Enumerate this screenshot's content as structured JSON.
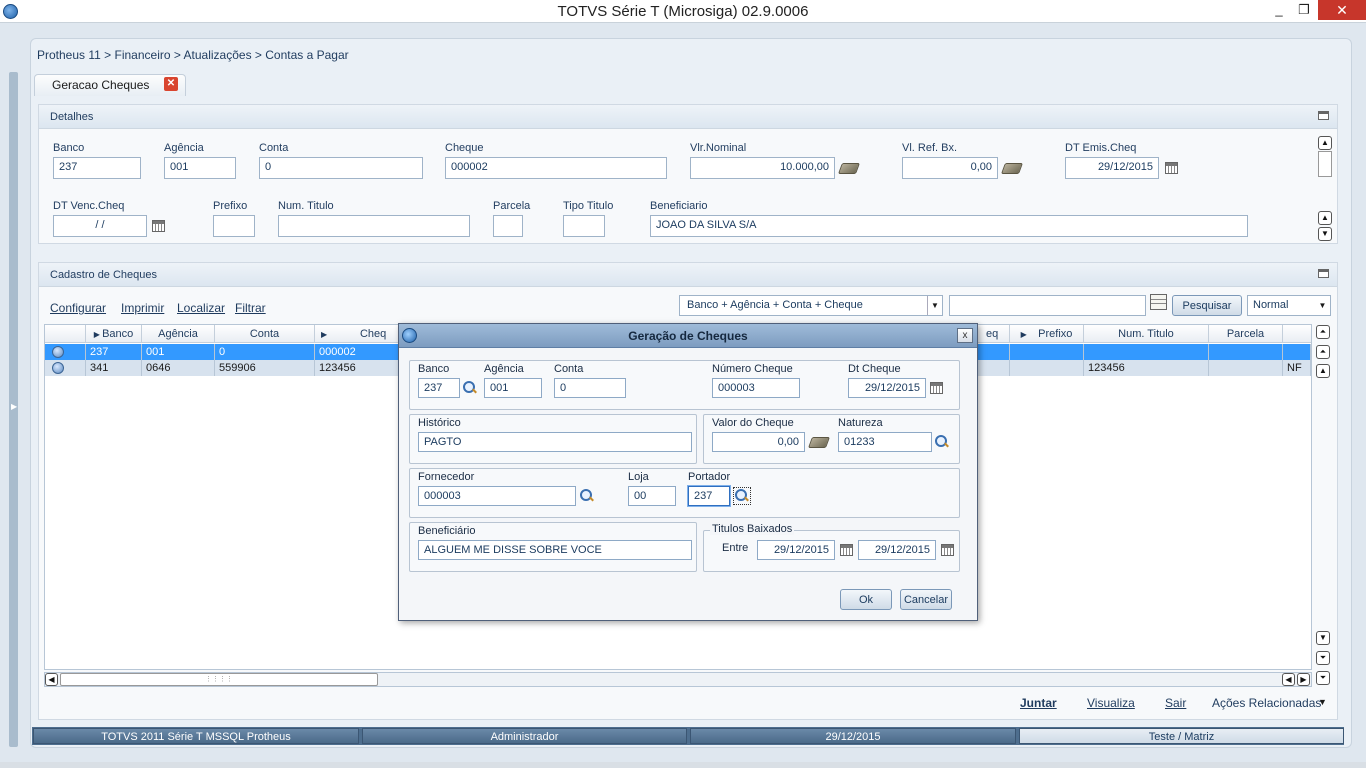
{
  "window": {
    "title": "TOTVS Série T  (Microsiga) 02.9.0006",
    "minimize": "_",
    "restore": "❐",
    "close": "✕"
  },
  "breadcrumb": "Protheus 11 > Financeiro > Atualizações > Contas a Pagar",
  "tab": {
    "label": "Geracao Cheques",
    "close": "✕"
  },
  "detalhes": {
    "title": "Detalhes",
    "fields": {
      "banco": {
        "label": "Banco",
        "value": "237"
      },
      "agencia": {
        "label": "Agência",
        "value": "001"
      },
      "conta": {
        "label": "Conta",
        "value": "0"
      },
      "cheque": {
        "label": "Cheque",
        "value": "000002"
      },
      "vlr_nominal": {
        "label": "Vlr.Nominal",
        "value": "10.000,00"
      },
      "vl_ref_bx": {
        "label": "Vl. Ref. Bx.",
        "value": "0,00"
      },
      "dt_emis": {
        "label": "DT Emis.Cheq",
        "value": "29/12/2015"
      },
      "dt_venc": {
        "label": "DT Venc.Cheq",
        "value": "  /  /"
      },
      "prefixo": {
        "label": "Prefixo",
        "value": ""
      },
      "num_titulo": {
        "label": "Num. Titulo",
        "value": ""
      },
      "parcela": {
        "label": "Parcela",
        "value": ""
      },
      "tipo_titulo": {
        "label": "Tipo Titulo",
        "value": ""
      },
      "beneficiario": {
        "label": "Beneficiario",
        "value": "JOAO DA SILVA S/A"
      }
    }
  },
  "cadastro": {
    "title": "Cadastro de Cheques",
    "links": {
      "configurar": "Configurar",
      "imprimir": "Imprimir",
      "localizar": "Localizar",
      "filtrar": "Filtrar"
    },
    "index_select": "Banco + Agência + Conta + Cheque",
    "search_value": "",
    "search_button": "Pesquisar",
    "view_select": "Normal",
    "columns": {
      "banco": "Banco",
      "agencia": "Agência",
      "conta": "Conta",
      "cheque": "Cheq",
      "cheque_right": "eq",
      "prefixo": "Prefixo",
      "num_titulo": "Num. Titulo",
      "parcela": "Parcela"
    },
    "rows": [
      {
        "banco": "237",
        "agencia": "001",
        "conta": "0",
        "cheque": "000002",
        "num_titulo": "",
        "tipo": ""
      },
      {
        "banco": "341",
        "agencia": "0646",
        "conta": "559906",
        "cheque": "123456",
        "num_titulo": "123456",
        "tipo": "NF"
      }
    ]
  },
  "footer": {
    "juntar": "Juntar",
    "visualiza": "Visualiza",
    "sair": "Sair",
    "acoes": "Ações Relacionadas"
  },
  "status": {
    "system": "TOTVS 2011 Série T  MSSQL Protheus",
    "user": "Administrador",
    "date": "29/12/2015",
    "company": "Teste / Matriz"
  },
  "dialog": {
    "title": "Geração de Cheques",
    "close": "x",
    "banco": {
      "label": "Banco",
      "value": "237"
    },
    "agencia": {
      "label": "Agência",
      "value": "001"
    },
    "conta": {
      "label": "Conta",
      "value": "0"
    },
    "numero_cheque": {
      "label": "Número Cheque",
      "value": "000003"
    },
    "dt_cheque": {
      "label": "Dt Cheque",
      "value": "29/12/2015"
    },
    "historico": {
      "label": "Histórico",
      "value": "PAGTO"
    },
    "valor_cheque": {
      "label": "Valor do Cheque",
      "value": "0,00"
    },
    "natureza": {
      "label": "Natureza",
      "value": "01233"
    },
    "fornecedor": {
      "label": "Fornecedor",
      "value": "000003"
    },
    "loja": {
      "label": "Loja",
      "value": "00"
    },
    "portador": {
      "label": "Portador",
      "value": "237"
    },
    "beneficiario": {
      "label": "Beneficiário",
      "value": "ALGUEM ME DISSE SOBRE VOCE"
    },
    "titulos_baixados": {
      "label": "Titulos Baixados",
      "entre": "Entre",
      "from": "29/12/2015",
      "to": "29/12/2015"
    },
    "ok": "Ok",
    "cancel": "Cancelar"
  }
}
